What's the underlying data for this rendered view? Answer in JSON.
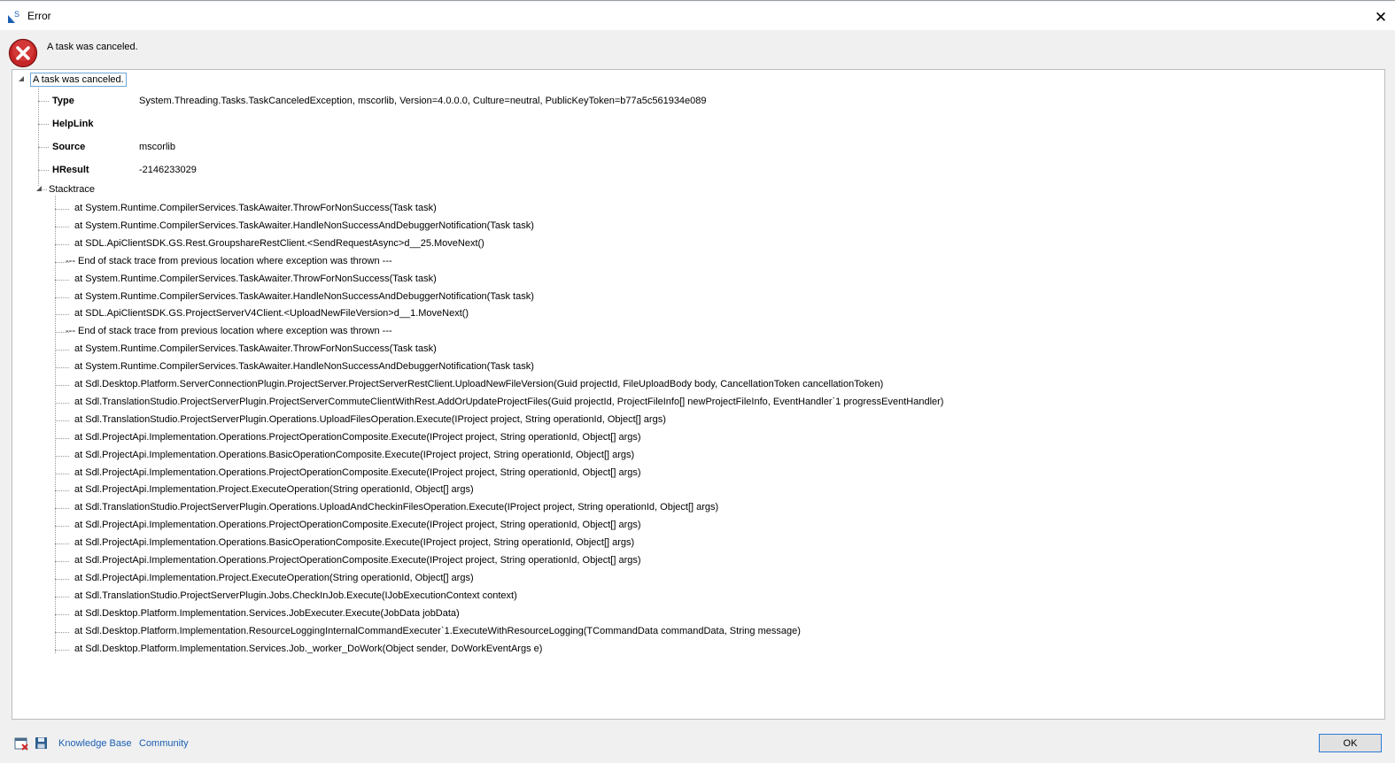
{
  "window": {
    "title": "Error",
    "close_glyph": "✕"
  },
  "header": {
    "message": "A task was canceled."
  },
  "tree": {
    "root_label": "A task was canceled.",
    "properties": [
      {
        "name": "Type",
        "value": "System.Threading.Tasks.TaskCanceledException, mscorlib, Version=4.0.0.0, Culture=neutral, PublicKeyToken=b77a5c561934e089"
      },
      {
        "name": "HelpLink",
        "value": ""
      },
      {
        "name": "Source",
        "value": "mscorlib"
      },
      {
        "name": "HResult",
        "value": "-2146233029"
      }
    ],
    "stacktrace_label": "Stacktrace",
    "stacktrace": [
      "at System.Runtime.CompilerServices.TaskAwaiter.ThrowForNonSuccess(Task task)",
      "at System.Runtime.CompilerServices.TaskAwaiter.HandleNonSuccessAndDebuggerNotification(Task task)",
      "at SDL.ApiClientSDK.GS.Rest.GroupshareRestClient.<SendRequestAsync>d__25.MoveNext()",
      "--- End of stack trace from previous location where exception was thrown ---",
      "at System.Runtime.CompilerServices.TaskAwaiter.ThrowForNonSuccess(Task task)",
      "at System.Runtime.CompilerServices.TaskAwaiter.HandleNonSuccessAndDebuggerNotification(Task task)",
      "at SDL.ApiClientSDK.GS.ProjectServerV4Client.<UploadNewFileVersion>d__1.MoveNext()",
      "--- End of stack trace from previous location where exception was thrown ---",
      "at System.Runtime.CompilerServices.TaskAwaiter.ThrowForNonSuccess(Task task)",
      "at System.Runtime.CompilerServices.TaskAwaiter.HandleNonSuccessAndDebuggerNotification(Task task)",
      "at Sdl.Desktop.Platform.ServerConnectionPlugin.ProjectServer.ProjectServerRestClient.UploadNewFileVersion(Guid projectId, FileUploadBody body, CancellationToken cancellationToken)",
      "at Sdl.TranslationStudio.ProjectServerPlugin.ProjectServerCommuteClientWithRest.AddOrUpdateProjectFiles(Guid projectId, ProjectFileInfo[] newProjectFileInfo, EventHandler`1 progressEventHandler)",
      "at Sdl.TranslationStudio.ProjectServerPlugin.Operations.UploadFilesOperation.Execute(IProject project, String operationId, Object[] args)",
      "at Sdl.ProjectApi.Implementation.Operations.ProjectOperationComposite.Execute(IProject project, String operationId, Object[] args)",
      "at Sdl.ProjectApi.Implementation.Operations.BasicOperationComposite.Execute(IProject project, String operationId, Object[] args)",
      "at Sdl.ProjectApi.Implementation.Operations.ProjectOperationComposite.Execute(IProject project, String operationId, Object[] args)",
      "at Sdl.ProjectApi.Implementation.Project.ExecuteOperation(String operationId, Object[] args)",
      "at Sdl.TranslationStudio.ProjectServerPlugin.Operations.UploadAndCheckinFilesOperation.Execute(IProject project, String operationId, Object[] args)",
      "at Sdl.ProjectApi.Implementation.Operations.ProjectOperationComposite.Execute(IProject project, String operationId, Object[] args)",
      "at Sdl.ProjectApi.Implementation.Operations.BasicOperationComposite.Execute(IProject project, String operationId, Object[] args)",
      "at Sdl.ProjectApi.Implementation.Operations.ProjectOperationComposite.Execute(IProject project, String operationId, Object[] args)",
      "at Sdl.ProjectApi.Implementation.Project.ExecuteOperation(String operationId, Object[] args)",
      "at Sdl.TranslationStudio.ProjectServerPlugin.Jobs.CheckInJob.Execute(IJobExecutionContext context)",
      "at Sdl.Desktop.Platform.Implementation.Services.JobExecuter.Execute(JobData jobData)",
      "at Sdl.Desktop.Platform.Implementation.ResourceLoggingInternalCommandExecuter`1.ExecuteWithResourceLogging(TCommandData commandData, String message)",
      "at Sdl.Desktop.Platform.Implementation.Services.Job._worker_DoWork(Object sender, DoWorkEventArgs e)"
    ]
  },
  "footer": {
    "links": [
      "Knowledge Base",
      "Community"
    ],
    "ok_label": "OK",
    "icons": [
      "report-icon",
      "save-icon"
    ]
  },
  "colors": {
    "link": "#1a5fb4",
    "error_red": "#d12b2b",
    "ok_border": "#2a7bd6"
  }
}
